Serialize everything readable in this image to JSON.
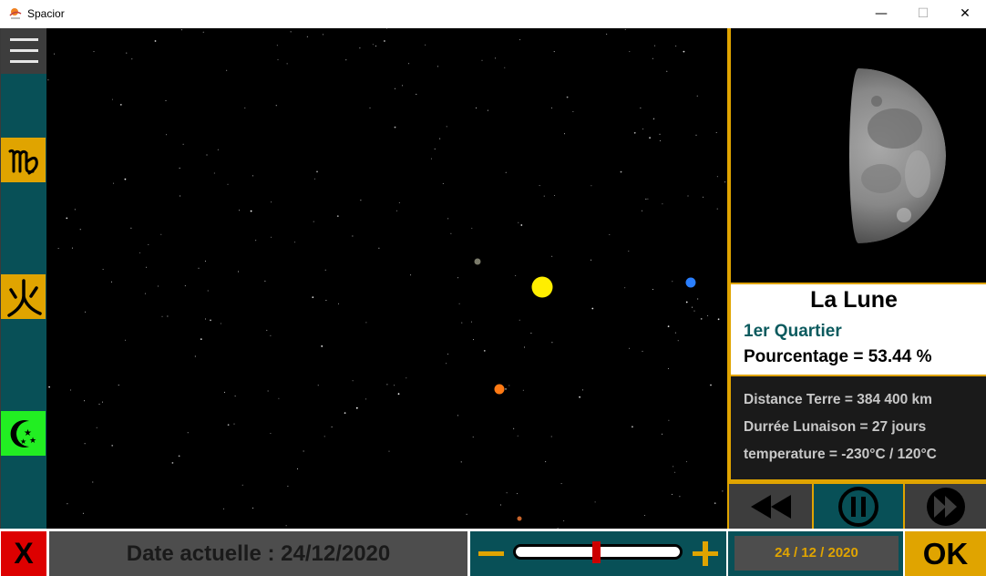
{
  "window": {
    "title": "Spacior",
    "minimize_glyph": "—",
    "maximize_glyph": "☐",
    "close_glyph": "✕"
  },
  "sidebar": {
    "items": [
      {
        "icon": "hamburger-menu-icon"
      },
      {
        "icon": "virgo-zodiac-icon"
      },
      {
        "icon": "fire-kanji-icon"
      },
      {
        "icon": "crescent-moon-stars-icon"
      }
    ]
  },
  "space_view": {
    "bodies": [
      {
        "name": "sun",
        "color": "#ffee00"
      },
      {
        "name": "planet-blue",
        "color": "#2a7fff"
      },
      {
        "name": "planet-orange",
        "color": "#ff7a14"
      },
      {
        "name": "planet-gray",
        "color": "#7a7a6a"
      },
      {
        "name": "planet-small-brown",
        "color": "#c8642a"
      }
    ]
  },
  "info_panel": {
    "name": "La Lune",
    "phase": "1er Quartier",
    "percentage": "Pourcentage = 53.44 %",
    "distance": "Distance Terre = 384 400 km",
    "lunation": "Durrée Lunaison = 27 jours",
    "temperature": "temperature = -230°C / 120°C"
  },
  "controls": {
    "rewind_icon": "rewind-icon",
    "pause_icon": "pause-icon",
    "forward_icon": "fast-forward-icon"
  },
  "bottom_bar": {
    "exit_label": "X",
    "date_label": "Date actuelle : 24/12/2020",
    "date_input_value": "24 / 12 / 2020",
    "ok_label": "OK"
  },
  "colors": {
    "accent_gold": "#e0a400",
    "teal": "#085057",
    "dark_gray": "#3d3d3d",
    "exit_red": "#dd0000",
    "moon_green": "#22ee22"
  }
}
